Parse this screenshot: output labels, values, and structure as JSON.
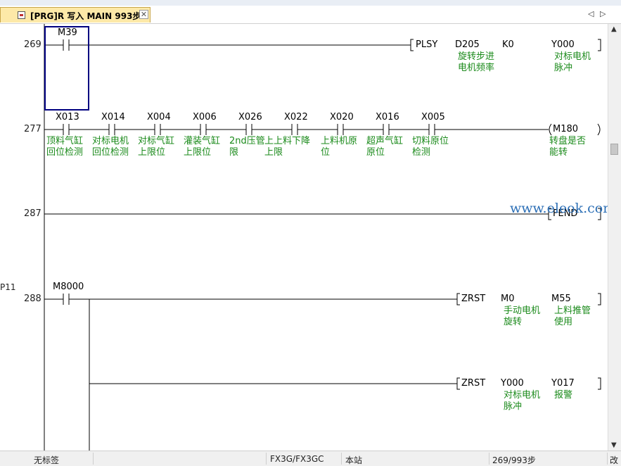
{
  "tab": {
    "label": "[PRG]R 写入 MAIN 993步",
    "close": "✕"
  },
  "nav": {
    "prev": "◁",
    "next": "▷"
  },
  "side_label": "P11",
  "rungs": [
    {
      "step": "269",
      "contacts": [
        "M39"
      ],
      "instruction": {
        "op": "PLSY",
        "args": [
          "D205",
          "K0",
          "Y000"
        ],
        "comments": [
          "旋转步进\n电机频率",
          "",
          "对标电机\n脉冲"
        ]
      }
    },
    {
      "step": "277",
      "contacts": [
        "X013",
        "X014",
        "X004",
        "X006",
        "X026",
        "X022",
        "X020",
        "X016",
        "X005"
      ],
      "contact_comments": [
        "顶料气缸\n回位检测",
        "对标电机\n回位检测",
        "对标气缸\n上限位",
        "灌装气缸\n上限位",
        "2nd压管\n限",
        "上上料下降\n上限",
        "上料机原\n位",
        "超声气缸\n原位",
        "切料原位\n检测"
      ],
      "coil": {
        "label": "M180",
        "comment": "转盘是否\n能转"
      }
    },
    {
      "step": "287",
      "instruction": {
        "op": "FEND"
      }
    },
    {
      "step": "288",
      "contacts": [
        "M8000"
      ],
      "instructions": [
        {
          "op": "ZRST",
          "args": [
            "M0",
            "M55"
          ],
          "comments": [
            "手动电机\n旋转",
            "上料推管\n使用"
          ]
        },
        {
          "op": "ZRST",
          "args": [
            "Y000",
            "Y017"
          ],
          "comments": [
            "对标电机\n脉冲",
            "报警"
          ]
        }
      ]
    }
  ],
  "watermark": "www.eleok.com",
  "status": {
    "label": "无标签",
    "plc": "FX3G/FX3GC",
    "station": "本站",
    "steps": "269/993步",
    "mode": "改"
  },
  "colors": {
    "comment": "#1a8a1a",
    "watermark": "#2c6fb6",
    "tab": "#fde9a8",
    "cursor": "#000080"
  }
}
